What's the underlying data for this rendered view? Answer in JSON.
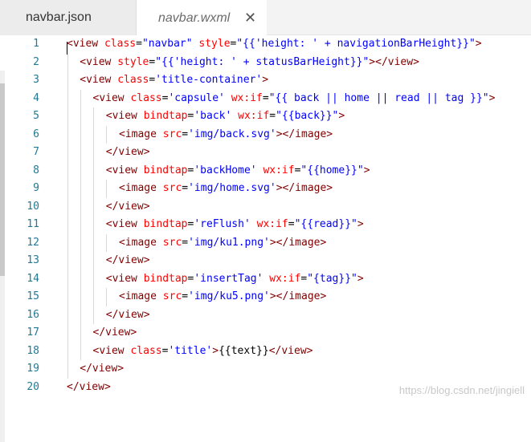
{
  "tabs": [
    {
      "label": "navbar.json",
      "active": false
    },
    {
      "label": "navbar.wxml",
      "active": true
    }
  ],
  "tab_close_icon": "close-icon",
  "code_lines": [
    {
      "n": "1",
      "parts": [
        [
          "tg",
          "<view "
        ],
        [
          "at",
          "class"
        ],
        [
          "tx",
          "="
        ],
        [
          "sv",
          "\"navbar\""
        ],
        [
          "tx",
          " "
        ],
        [
          "at",
          "style"
        ],
        [
          "tx",
          "="
        ],
        [
          "sv",
          "\"{{'height: ' + navigationBarHeight}}\""
        ],
        [
          "tg",
          ">"
        ]
      ]
    },
    {
      "n": "2",
      "parts": [
        [
          "tg",
          "<view "
        ],
        [
          "at",
          "style"
        ],
        [
          "tx",
          "="
        ],
        [
          "sv",
          "\"{{'height: ' + statusBarHeight}}\""
        ],
        [
          "tg",
          "></view>"
        ]
      ]
    },
    {
      "n": "3",
      "parts": [
        [
          "tg",
          "<view "
        ],
        [
          "at",
          "class"
        ],
        [
          "tx",
          "="
        ],
        [
          "sv",
          "'title-container'"
        ],
        [
          "tg",
          ">"
        ]
      ]
    },
    {
      "n": "4",
      "parts": [
        [
          "tg",
          "<view "
        ],
        [
          "at",
          "class"
        ],
        [
          "tx",
          "="
        ],
        [
          "sv",
          "'capsule'"
        ],
        [
          "tx",
          " "
        ],
        [
          "at",
          "wx:if"
        ],
        [
          "tx",
          "="
        ],
        [
          "sv",
          "\"{{ back || home || read || tag }}\""
        ],
        [
          "tg",
          ">"
        ]
      ]
    },
    {
      "n": "5",
      "parts": [
        [
          "tg",
          "<view "
        ],
        [
          "at",
          "bindtap"
        ],
        [
          "tx",
          "="
        ],
        [
          "sv",
          "'back'"
        ],
        [
          "tx",
          " "
        ],
        [
          "at",
          "wx:if"
        ],
        [
          "tx",
          "="
        ],
        [
          "sv",
          "\"{{back}}\""
        ],
        [
          "tg",
          ">"
        ]
      ]
    },
    {
      "n": "6",
      "parts": [
        [
          "tg",
          "<image "
        ],
        [
          "at",
          "src"
        ],
        [
          "tx",
          "="
        ],
        [
          "sv",
          "'img/back.svg'"
        ],
        [
          "tg",
          "></image>"
        ]
      ]
    },
    {
      "n": "7",
      "parts": [
        [
          "tg",
          "</view>"
        ]
      ]
    },
    {
      "n": "8",
      "parts": [
        [
          "tg",
          "<view "
        ],
        [
          "at",
          "bindtap"
        ],
        [
          "tx",
          "="
        ],
        [
          "sv",
          "'backHome'"
        ],
        [
          "tx",
          " "
        ],
        [
          "at",
          "wx:if"
        ],
        [
          "tx",
          "="
        ],
        [
          "sv",
          "\"{{home}}\""
        ],
        [
          "tg",
          ">"
        ]
      ]
    },
    {
      "n": "9",
      "parts": [
        [
          "tg",
          "<image "
        ],
        [
          "at",
          "src"
        ],
        [
          "tx",
          "="
        ],
        [
          "sv",
          "'img/home.svg'"
        ],
        [
          "tg",
          "></image>"
        ]
      ]
    },
    {
      "n": "10",
      "parts": [
        [
          "tg",
          "</view>"
        ]
      ]
    },
    {
      "n": "11",
      "parts": [
        [
          "tg",
          "<view "
        ],
        [
          "at",
          "bindtap"
        ],
        [
          "tx",
          "="
        ],
        [
          "sv",
          "'reFlush'"
        ],
        [
          "tx",
          " "
        ],
        [
          "at",
          "wx:if"
        ],
        [
          "tx",
          "="
        ],
        [
          "sv",
          "\"{{read}}\""
        ],
        [
          "tg",
          ">"
        ]
      ]
    },
    {
      "n": "12",
      "parts": [
        [
          "tg",
          "<image "
        ],
        [
          "at",
          "src"
        ],
        [
          "tx",
          "="
        ],
        [
          "sv",
          "'img/ku1.png'"
        ],
        [
          "tg",
          "></image>"
        ]
      ]
    },
    {
      "n": "13",
      "parts": [
        [
          "tg",
          "</view>"
        ]
      ]
    },
    {
      "n": "14",
      "parts": [
        [
          "tg",
          "<view "
        ],
        [
          "at",
          "bindtap"
        ],
        [
          "tx",
          "="
        ],
        [
          "sv",
          "'insertTag'"
        ],
        [
          "tx",
          " "
        ],
        [
          "at",
          "wx:if"
        ],
        [
          "tx",
          "="
        ],
        [
          "sv",
          "\"{tag}}\""
        ],
        [
          "tg",
          ">"
        ]
      ]
    },
    {
      "n": "15",
      "parts": [
        [
          "tg",
          "<image "
        ],
        [
          "at",
          "src"
        ],
        [
          "tx",
          "="
        ],
        [
          "sv",
          "'img/ku5.png'"
        ],
        [
          "tg",
          "></image>"
        ]
      ]
    },
    {
      "n": "16",
      "parts": [
        [
          "tg",
          "</view>"
        ]
      ]
    },
    {
      "n": "17",
      "parts": [
        [
          "tg",
          "</view>"
        ]
      ]
    },
    {
      "n": "18",
      "parts": [
        [
          "tg",
          "<view "
        ],
        [
          "at",
          "class"
        ],
        [
          "tx",
          "="
        ],
        [
          "sv",
          "'title'"
        ],
        [
          "tg",
          ">"
        ],
        [
          "tx",
          "{{text}}"
        ],
        [
          "tg",
          "</view>"
        ]
      ]
    },
    {
      "n": "19",
      "parts": [
        [
          "tg",
          "</view>"
        ]
      ]
    },
    {
      "n": "20",
      "parts": [
        [
          "tg",
          "</view>"
        ]
      ]
    }
  ],
  "watermark": "https://blog.csdn.net/jingiell",
  "colors": {
    "tag": "#800000",
    "attr": "#ff0000",
    "value": "#0000ff",
    "line_number": "#237893"
  }
}
